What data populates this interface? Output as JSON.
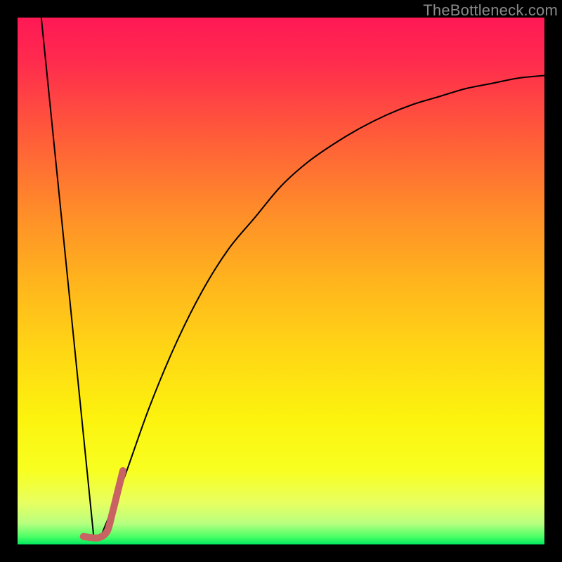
{
  "watermark": "TheBottleneck.com",
  "chart_data": {
    "type": "line",
    "title": "",
    "xlabel": "",
    "ylabel": "",
    "xlim": [
      0,
      100
    ],
    "ylim": [
      0,
      100
    ],
    "grid": false,
    "legend": false,
    "background_gradient": {
      "top": "#ff1955",
      "upper_mid": "#ff8a2a",
      "mid": "#ffd814",
      "lower_mid": "#fcf30e",
      "bottom": "#00e85e"
    },
    "series": [
      {
        "name": "left-falling-line",
        "stroke": "#000000",
        "width": 2,
        "x": [
          4.5,
          14.5
        ],
        "y": [
          100,
          1
        ]
      },
      {
        "name": "right-rising-curve",
        "stroke": "#000000",
        "width": 2,
        "x": [
          16,
          20,
          25,
          30,
          35,
          40,
          45,
          50,
          55,
          60,
          65,
          70,
          75,
          80,
          85,
          90,
          95,
          100
        ],
        "y": [
          2,
          12,
          26,
          38,
          48,
          56,
          62,
          68,
          72.5,
          76,
          79,
          81.5,
          83.5,
          85,
          86.5,
          87.5,
          88.5,
          89
        ]
      },
      {
        "name": "j-hook-marker",
        "stroke": "#c96262",
        "width": 10,
        "linecap": "round",
        "x": [
          12.5,
          14,
          15.5,
          17,
          18,
          19,
          20
        ],
        "y": [
          1.5,
          1.3,
          1.3,
          2.5,
          6,
          10,
          14
        ]
      }
    ]
  }
}
